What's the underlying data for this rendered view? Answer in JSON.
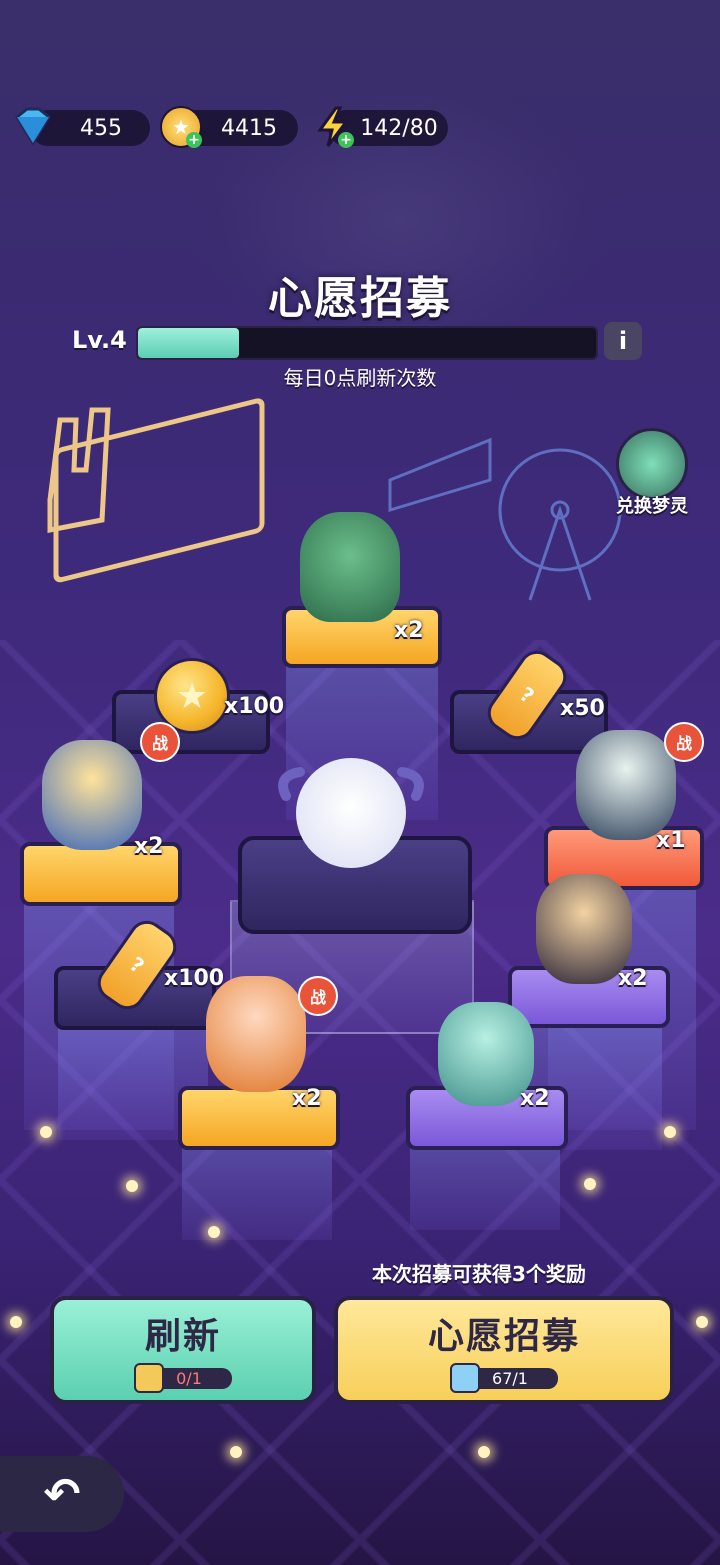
{
  "currency": {
    "gems": {
      "value": "455",
      "icon": "diamond-icon"
    },
    "coins": {
      "value": "4415",
      "icon": "gold-coin-icon"
    },
    "energy": {
      "value": "142/80",
      "icon": "lightning-icon"
    }
  },
  "title": "心愿招募",
  "level": {
    "label": "Lv.4",
    "progress": 0.22
  },
  "info_icon": "i",
  "refresh_note": "每日0点刷新次数",
  "exchange": {
    "label": "兑换梦灵"
  },
  "rewards": [
    {
      "id": "top-bunny",
      "qty": "x2",
      "battle": false
    },
    {
      "id": "coin",
      "qty": "x100",
      "battle": false
    },
    {
      "id": "bottle-1",
      "qty": "x50",
      "battle": false
    },
    {
      "id": "blonde-hero",
      "qty": "x2",
      "battle": true
    },
    {
      "id": "teal-hair",
      "qty": "x1",
      "battle": true
    },
    {
      "id": "cat-girl",
      "qty": "x2",
      "battle": false
    },
    {
      "id": "bottle-2",
      "qty": "x100",
      "battle": false
    },
    {
      "id": "pilot-boy",
      "qty": "x2",
      "battle": true
    },
    {
      "id": "slime-girl",
      "qty": "x2",
      "battle": false
    }
  ],
  "battle_badge": "战",
  "reward_note": "本次招募可获得3个奖励",
  "buttons": {
    "refresh": {
      "label": "刷新",
      "cost": "0/1"
    },
    "wish": {
      "label": "心愿招募",
      "cost": "67/1"
    }
  },
  "back_icon": "↶",
  "colors": {
    "accent_teal": "#5ccdb3",
    "accent_gold": "#f7cf5a",
    "battle_red": "#e8533a"
  }
}
